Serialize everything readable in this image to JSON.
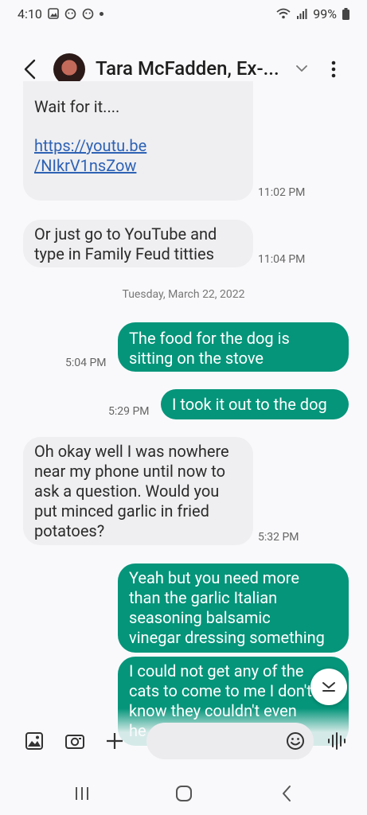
{
  "status": {
    "time": "4:10",
    "battery": "99%"
  },
  "header": {
    "contact_name": "Tara McFadden, Ex-..."
  },
  "messages": {
    "m1": {
      "text_line1": "Wait for it....",
      "link_line1": "https://youtu.be",
      "link_line2": "/NIkrV1nsZow",
      "time": "11:02 PM"
    },
    "m2": {
      "line1": "Or just go to YouTube and",
      "line2": "type in Family Feud titties",
      "time": "11:04 PM"
    },
    "date_separator": "Tuesday, March 22, 2022",
    "m3": {
      "line1": "The food for the dog is",
      "line2": "sitting on the stove",
      "time": "5:04 PM"
    },
    "m4": {
      "line1": "I took it out to the dog",
      "time": "5:29 PM"
    },
    "m5": {
      "line1": "Oh okay well I was nowhere",
      "line2": "near my phone until now to",
      "line3": "ask a question. Would you",
      "line4": "put minced garlic in fried",
      "line5": "potatoes?",
      "time": "5:32 PM"
    },
    "m6": {
      "line1": "Yeah but you need more",
      "line2": "than the garlic Italian",
      "line3": "seasoning balsamic",
      "line4": "vinegar dressing something"
    },
    "m7": {
      "line1": "I could not get any of the",
      "line2": "cats to come to me I don't",
      "line3": "know they couldn't even",
      "line4": "he"
    }
  },
  "input": {
    "placeholder": ""
  },
  "icons": {
    "back": "back-arrow-icon",
    "more": "more-vert-icon",
    "gallery": "gallery-icon",
    "camera": "camera-icon",
    "add": "plus-icon",
    "emoji": "emoji-icon",
    "voice": "voice-wave-icon",
    "scroll_down": "scroll-down-icon"
  },
  "colors": {
    "outgoing_bubble": "#05957a",
    "incoming_bubble": "#efeff1",
    "link": "#2e62b5"
  }
}
